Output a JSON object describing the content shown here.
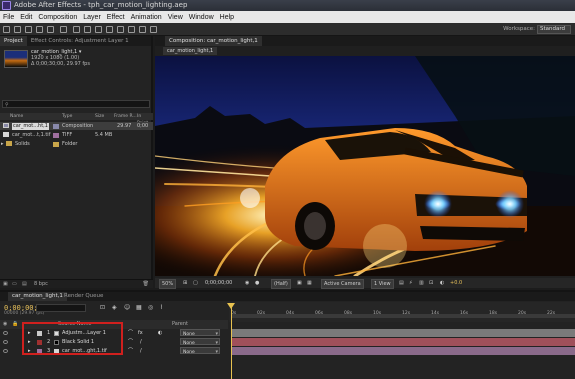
{
  "window": {
    "title": "Adobe After Effects - tph_car_motion_lighting.aep"
  },
  "menu": [
    "File",
    "Edit",
    "Composition",
    "Layer",
    "Effect",
    "Animation",
    "View",
    "Window",
    "Help"
  ],
  "toolbar": {
    "workspace_label": "Workspace:",
    "workspace_value": "Standard"
  },
  "project": {
    "tabs": [
      "Project",
      "Effect Controls: Adjustment Layer 1"
    ],
    "selected_name": "car_motion_light,1 ▾",
    "info": [
      "1920 x 1080 (1.00)",
      "Δ 0;00;30;00, 29.97 fps"
    ],
    "columns": [
      "Name",
      "Type",
      "Size",
      "Frame R...",
      "In Point"
    ],
    "rows": [
      {
        "name": "car_mot...ht,1",
        "type": "Composition",
        "size": "",
        "rate": "29.97",
        "in": "0;00"
      },
      {
        "name": "car_mot...t,1.tif",
        "type": "TIFF",
        "size": "5.4 MB",
        "rate": "",
        "in": ""
      },
      {
        "name": "Solids",
        "type": "Folder",
        "size": "",
        "rate": "",
        "in": ""
      }
    ],
    "footer_bpc": "8 bpc"
  },
  "composition": {
    "tab_label": "Composition: car_motion_light,1",
    "subtab": "car_motion_light,1",
    "viewer_bar": {
      "zoom": "50%",
      "timecode": "0;00;00;00",
      "resolution": "(Half)",
      "camera": "Active Camera",
      "views": "1 View",
      "exposure": "+0.0"
    }
  },
  "timeline": {
    "tabs": [
      "car_motion_light,1",
      "Render Queue"
    ],
    "timecode": "0;00;00;00",
    "frames": "00000 (29.97 fps)",
    "headers": {
      "source": "Source Name",
      "parent": "Parent"
    },
    "ruler_ticks": [
      "0s",
      "02s",
      "04s",
      "06s",
      "08s",
      "10s",
      "12s",
      "14s",
      "16s",
      "18s",
      "20s",
      "22s"
    ],
    "layers": [
      {
        "num": "1",
        "name": "Adjustm...Layer 1",
        "parent": "None",
        "color": "#c9c9c9",
        "bar": "#7a7a7a"
      },
      {
        "num": "2",
        "name": "Black Solid 1",
        "parent": "None",
        "color": "#a03030",
        "bar": "#a0505a"
      },
      {
        "num": "3",
        "name": "car_mot...ght,1.tif",
        "parent": "None",
        "color": "#a070a0",
        "bar": "#8a6a8a"
      }
    ]
  }
}
